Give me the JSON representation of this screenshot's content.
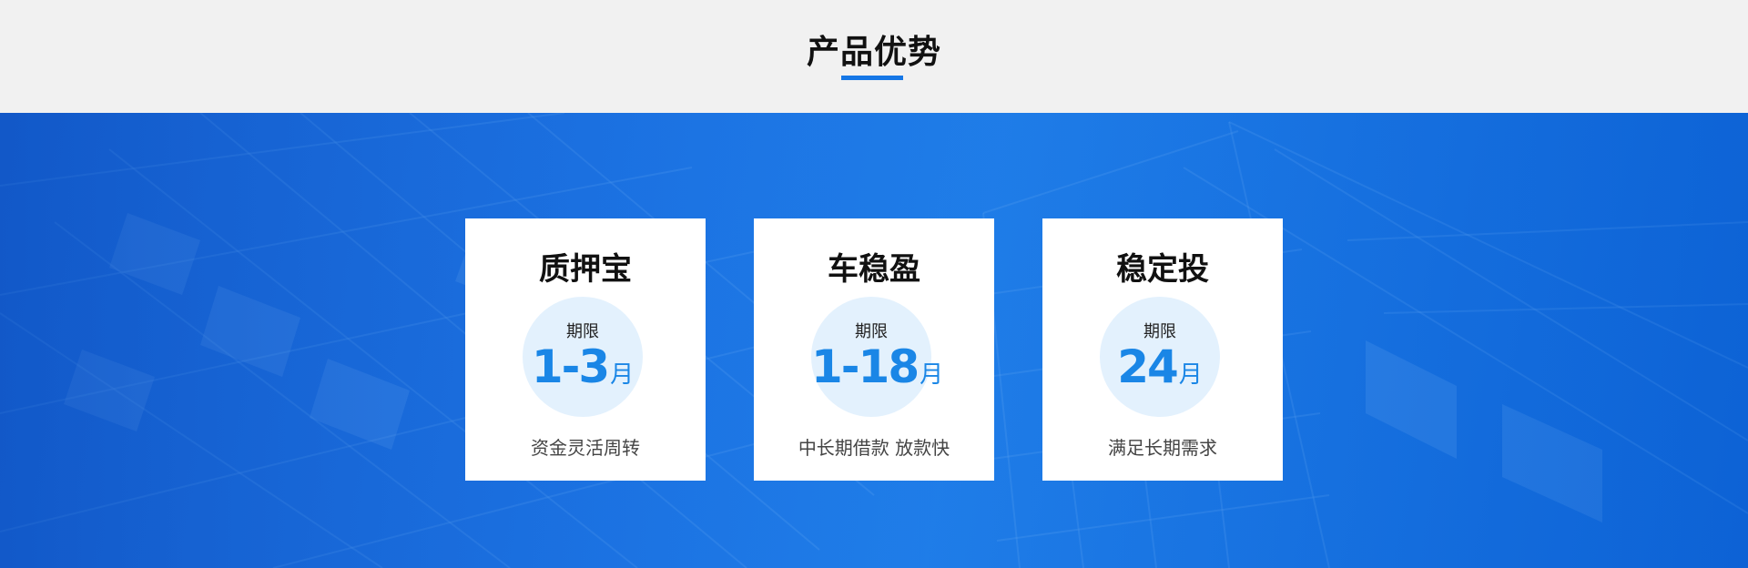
{
  "section": {
    "title": "产品优势"
  },
  "colors": {
    "accent": "#1677e6",
    "banner_blue": "#1c73e3",
    "circle_bg": "#e3f1fd",
    "number_blue": "#1a86e6"
  },
  "cards": [
    {
      "title": "质押宝",
      "term_label": "期限",
      "term_value": "1-3",
      "term_unit": "月",
      "description": "资金灵活周转"
    },
    {
      "title": "车稳盈",
      "term_label": "期限",
      "term_value": "1-18",
      "term_unit": "月",
      "description": "中长期借款 放款快"
    },
    {
      "title": "稳定投",
      "term_label": "期限",
      "term_value": "24",
      "term_unit": "月",
      "description": "满足长期需求"
    }
  ]
}
